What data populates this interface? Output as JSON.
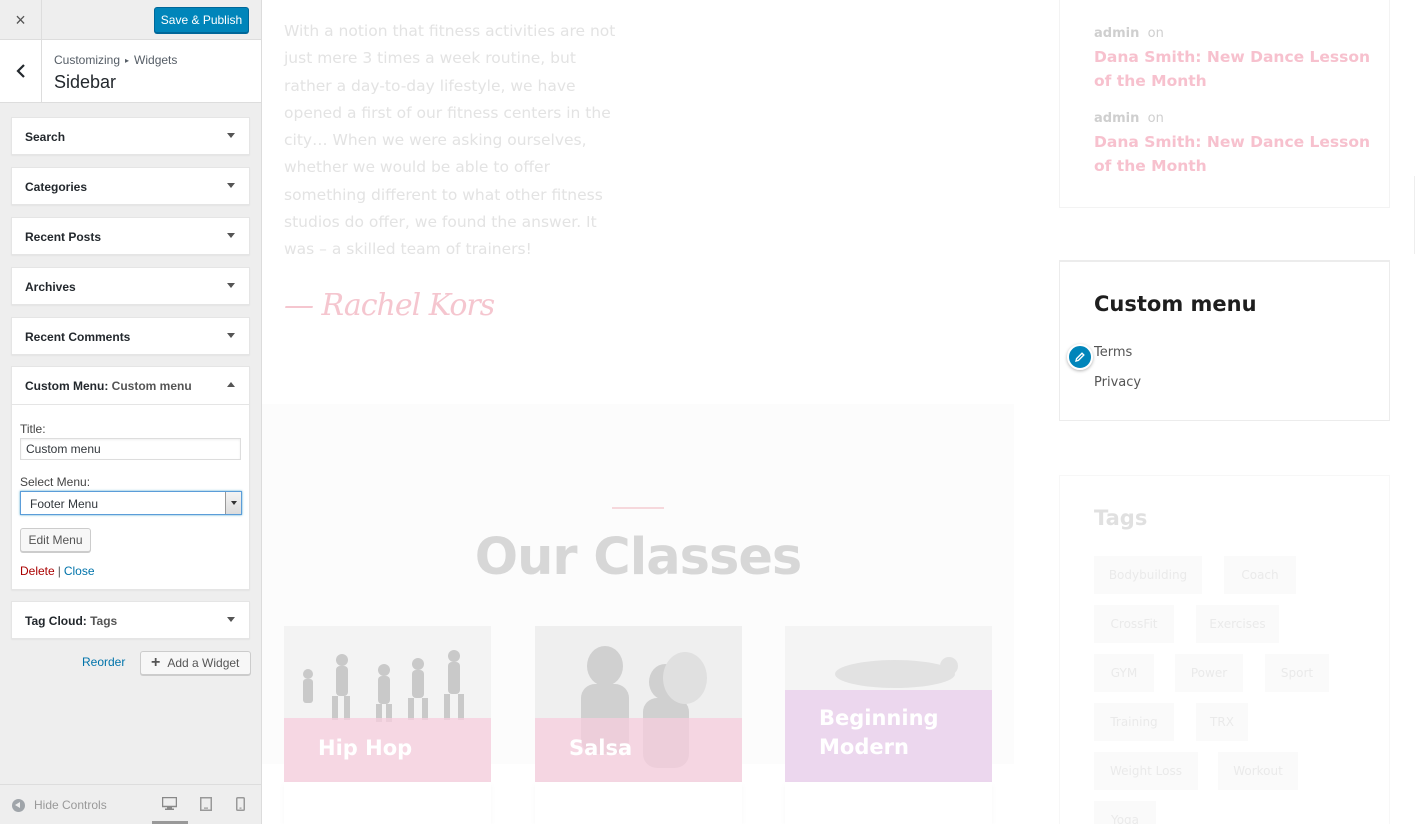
{
  "panel": {
    "header": {
      "close_icon": "×",
      "save_label": "Save & Publish"
    },
    "section": {
      "crumb_parent": "Customizing",
      "crumb_sep": "▸",
      "crumb_child": "Widgets",
      "title": "Sidebar"
    },
    "widgets": [
      {
        "label": "Search"
      },
      {
        "label": "Categories"
      },
      {
        "label": "Recent Posts"
      },
      {
        "label": "Archives"
      },
      {
        "label": "Recent Comments"
      }
    ],
    "custom_menu_widget": {
      "type": "Custom Menu:",
      "name": "Custom menu",
      "title_label": "Title:",
      "title_value": "Custom menu",
      "select_label": "Select Menu:",
      "select_value": "Footer Menu",
      "edit_menu": "Edit Menu",
      "delete": "Delete",
      "sep": "|",
      "close": "Close"
    },
    "tag_cloud_widget": {
      "type": "Tag Cloud:",
      "name": "Tags"
    },
    "reorder": "Reorder",
    "add_widget": "Add a Widget",
    "footer": {
      "hide_controls": "Hide Controls"
    }
  },
  "preview": {
    "quote": "With a notion that fitness activities are not just mere 3 times a week routine, but rather a day-to-day lifestyle, we have opened a first of our fitness centers in the city… When we were asking ourselves, whether we would be able to offer something different to what other fitness studios do offer, we found the answer. It was – a skilled team of trainers!",
    "signature": "— Rachel Kors",
    "classes": {
      "title": "Our Classes",
      "cards": [
        {
          "name": "Hip Hop"
        },
        {
          "name": "Salsa"
        },
        {
          "name": "Beginning Modern"
        }
      ]
    },
    "recent_comments": [
      {
        "author": "admin",
        "on": "on",
        "post": "Dana Smith: New Dance Lesson of the Month"
      },
      {
        "author": "admin",
        "on": "on",
        "post": "Dana Smith: New Dance Lesson of the Month"
      }
    ],
    "custom_menu": {
      "heading": "Custom menu",
      "items": [
        "Terms",
        "Privacy"
      ]
    },
    "tags": {
      "heading": "Tags",
      "items": [
        "Bodybuilding",
        "Coach",
        "CrossFit",
        "Exercises",
        "GYM",
        "Power",
        "Sport",
        "Training",
        "TRX",
        "Weight Loss",
        "Workout",
        "Yoga"
      ]
    }
  },
  "colors": {
    "primary": "#0085ba",
    "link": "#0073aa",
    "delete": "#a00000",
    "accent_pink": "#f7c1ce"
  }
}
